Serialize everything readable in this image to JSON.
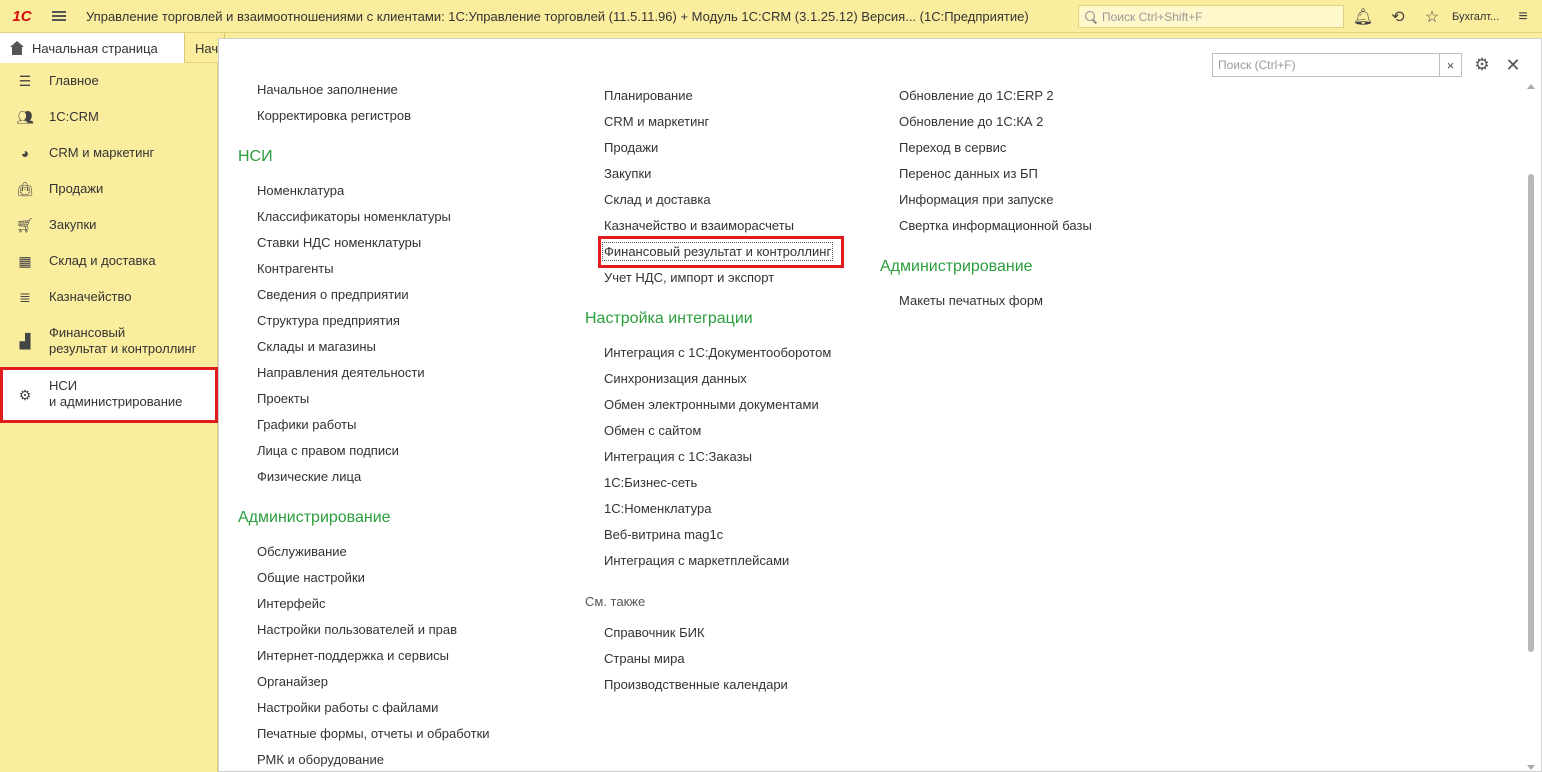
{
  "titlebar": {
    "logo": "1С",
    "title": "Управление торговлей и взаимоотношениями с клиентами: 1С:Управление торговлей (11.5.11.96) + Модуль 1С:CRM (3.1.25.12) Версия...  (1С:Предприятие)",
    "search_placeholder": "Поиск Ctrl+Shift+F",
    "user": "Бухгалт...",
    "icons": [
      "bell-icon",
      "history-icon",
      "star-icon",
      "more-icon"
    ]
  },
  "tabs": [
    {
      "label": "Начальная страница",
      "icon": "home-icon"
    },
    {
      "label": "Нач"
    }
  ],
  "sidebar": {
    "items": [
      {
        "label": "Главное",
        "icon": "menu-lines-icon"
      },
      {
        "label": "1С:CRM",
        "icon": "people-icon"
      },
      {
        "label": "CRM и маркетинг",
        "icon": "pie-chart-icon"
      },
      {
        "label": "Продажи",
        "icon": "bag-icon"
      },
      {
        "label": "Закупки",
        "icon": "cart-icon"
      },
      {
        "label": "Склад и доставка",
        "icon": "grid-icon"
      },
      {
        "label": "Казначейство",
        "icon": "coins-icon"
      },
      {
        "label": "Финансовый",
        "label2": "результат и контроллинг",
        "icon": "bar-chart-icon"
      },
      {
        "label": "НСИ",
        "label2": "и администрирование",
        "icon": "gear-icon",
        "active": true
      }
    ]
  },
  "panel": {
    "search_placeholder": "Поиск (Ctrl+F)",
    "clear_glyph": "×",
    "close_glyph": "✕",
    "col1": {
      "top_links": [
        "Начальное заполнение",
        "Корректировка регистров"
      ],
      "nsi_heading": "НСИ",
      "nsi_links": [
        "Номенклатура",
        "Классификаторы номенклатуры",
        "Ставки НДС номенклатуры",
        "Контрагенты",
        "Сведения о предприятии",
        "Структура предприятия",
        "Склады и магазины",
        "Направления деятельности",
        "Проекты",
        "Графики работы",
        "Лица с правом подписи",
        "Физические лица"
      ],
      "admin_heading": "Администрирование",
      "admin_links": [
        "Обслуживание",
        "Общие настройки",
        "Интерфейс",
        "Настройки пользователей и прав",
        "Интернет-поддержка и сервисы",
        "Органайзер",
        "Настройки работы с файлами",
        "Печатные формы, отчеты и обработки",
        "РМК и оборудование"
      ]
    },
    "col2": {
      "top_links": [
        "Планирование",
        "CRM и маркетинг",
        "Продажи",
        "Закупки",
        "Склад и доставка",
        "Казначейство и взаиморасчеты",
        "Финансовый результат и контроллинг",
        "Учет НДС, импорт и экспорт"
      ],
      "integration_heading": "Настройка интеграции",
      "integration_links": [
        "Интеграция с 1С:Документооборотом",
        "Синхронизация данных",
        "Обмен электронными документами",
        "Обмен с сайтом",
        "Интеграция с 1С:Заказы",
        "1С:Бизнес-сеть",
        "1С:Номенклатура",
        "Веб-витрина mag1c",
        "Интеграция с маркетплейсами"
      ],
      "see_also_heading": "См. также",
      "see_also_links": [
        "Справочник БИК",
        "Страны мира",
        "Производственные календари"
      ]
    },
    "col3": {
      "top_links": [
        "Обновление до 1С:ERP 2",
        "Обновление до 1С:КА 2",
        "Переход в сервис",
        "Перенос данных из БП",
        "Информация при запуске",
        "Свертка информационной базы"
      ],
      "admin_heading": "Администрирование",
      "admin_links": [
        "Макеты печатных форм"
      ]
    }
  },
  "colors": {
    "accent_bg": "#fbed9e",
    "heading_green": "#2a9d3c",
    "highlight_red": "#e01b1b"
  }
}
